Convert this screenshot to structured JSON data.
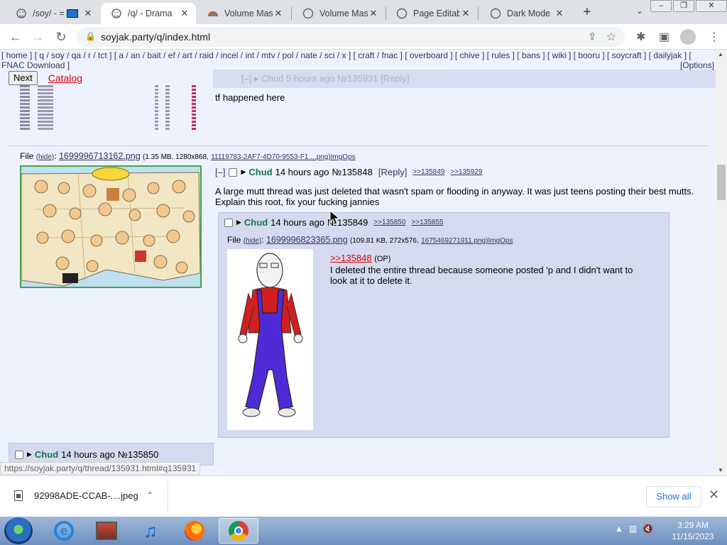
{
  "browser": {
    "tabs": [
      {
        "title": "/soy/ - ="
      },
      {
        "title": "/q/ - Drama"
      },
      {
        "title": "Volume Mast"
      },
      {
        "title": "Volume Mast"
      },
      {
        "title": "Page Editabl"
      },
      {
        "title": "Dark Mode"
      }
    ],
    "url": "soyjak.party/q/index.html",
    "new_tab": "+",
    "tab_menu": "⌄"
  },
  "board": {
    "nav_line1": "[ home ] [ q / soy / qa / r / tct ] [ a / an / bait / ef / art / raid / incel / int / mtv / pol / nate / sci / x ] [ craft / fnac ] [ overboard ] [ chive ] [ rules ] [ bans ] [ wiki ] [ booru ] [ soycraft ] [ dailyjak ] [",
    "nav_line2": "FNAC Download ]",
    "options": "[Options]",
    "next_label": "Next",
    "catalog_label": "Catalog",
    "ghost_header": "[–]  ▸ Chud 5 hours ago №135931  [Reply]",
    "prev_post_text": "tf happened here"
  },
  "op_post": {
    "file_label": "File",
    "hide": "(hide)",
    "filename": "1699996713162.png",
    "fileinfo": "(1.35 MB, 1280x868,",
    "orig_name": "11119783-2AF7-4D70-9553-F1....png)",
    "imgops": "ImgOps",
    "collapse": "[–]",
    "name": "Chud",
    "date": "14 hours ago",
    "postno": "№135848",
    "reply": "[Reply]",
    "backlinks": [
      ">>135849",
      ">>135929"
    ],
    "body": "A large mutt thread was just deleted that wasn't spam or flooding in anyway. It was just teens posting their best mutts. Explain this root, fix your fucking jannies"
  },
  "reply_post": {
    "name": "Chud",
    "date": "14 hours ago",
    "postno": "№135849",
    "backlinks": [
      ">>135850",
      ">>135855"
    ],
    "file_label": "File",
    "hide": "(hide)",
    "filename": "1699996823365.png",
    "fileinfo": "(109.81 KB, 272x576,",
    "orig_name": "1675469271911.png)",
    "imgops": "ImgOps",
    "quote": ">>135848",
    "op_tag": "(OP)",
    "body": "I deleted the entire thread because someone posted 'p and I didn't want to look at it to delete it."
  },
  "next_post": {
    "name": "Chud",
    "date": "14 hours ago",
    "postno": "№135850"
  },
  "status_url": "https://soyjak.party/q/thread/135931.html#q135931",
  "download": {
    "filename": "92998ADE-CCAB-....jpeg",
    "show_all": "Show all"
  },
  "taskbar": {
    "time": "3:29 AM",
    "date": "11/15/2023"
  }
}
